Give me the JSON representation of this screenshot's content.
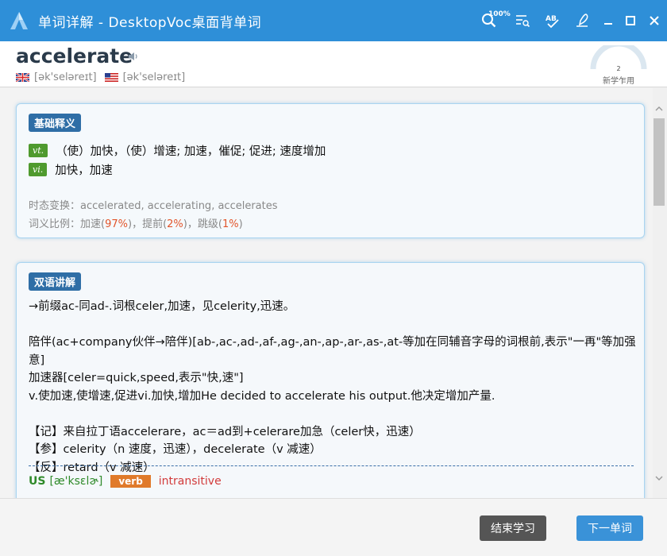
{
  "window": {
    "title": "单词详解 - DesktopVoc桌面背单词",
    "zoom_label": "100%"
  },
  "word": {
    "headword": "accelerate",
    "phonetic_uk": "[ək'seləreɪt]",
    "phonetic_us": "[ək'seləreɪt]",
    "progress_count": "2",
    "progress_status": "新学乍用"
  },
  "basic": {
    "tag": "基础释义",
    "definitions": [
      {
        "pos": "vt.",
        "text": "（使）加快，（使）增速; 加速，催促; 促进; 速度增加"
      },
      {
        "pos": "vi.",
        "text": "加快，加速"
      }
    ],
    "inflections_label": "时态变换：",
    "inflections": "accelerated, accelerating, accelerates",
    "ratio_label": "词义比例：",
    "ratio_1_word": "加速(",
    "ratio_1_pct": "97%",
    "ratio_2_word": ")，提前(",
    "ratio_2_pct": "2%",
    "ratio_3_word": ")，跳级(",
    "ratio_3_pct": "1%",
    "ratio_end": ")"
  },
  "bilingual": {
    "tag": "双语讲解",
    "lines": [
      "→前缀ac-同ad-.词根celer,加速，见celerity,迅速。",
      "",
      "陪伴(ac+company伙伴→陪伴)[ab-,ac-,ad-,af-,ag-,an-,ap-,ar-,as-,at-等加在同辅音字母的词根前,表示\"一再\"等加强意]",
      "加速器[celer=quick,speed,表示\"快,速\"]",
      "v.使加速,使增速,促进vi.加快,增加He decided to accelerate his output.他决定增加产量.",
      "",
      "【记】来自拉丁语accelerare，ac＝ad到+celerare加急（celer快，迅速）",
      "【参】celerity（n 速度，迅速），decelerate（v 减速）",
      "【反】retard（v 减速）"
    ],
    "us_label": "US",
    "us_phonetic": "[æ'ksɛlɚ]",
    "verb_tag": "verb",
    "intransitive": "intransitive"
  },
  "footer": {
    "end_label": "结束学习",
    "next_label": "下一单词"
  },
  "colors": {
    "titlebar": "#2e8fd8",
    "tag": "#2f6ea6",
    "pos": "#4f9a2e",
    "percent": "#e2552b",
    "next_button": "#3a92d8",
    "end_button": "#555555"
  },
  "icons": [
    "app-logo-icon",
    "zoom-icon",
    "list-icon",
    "spell-check-icon",
    "pen-icon",
    "minimize-icon",
    "maximize-icon",
    "close-icon",
    "speaker-icon",
    "uk-flag-icon",
    "us-flag-icon"
  ]
}
